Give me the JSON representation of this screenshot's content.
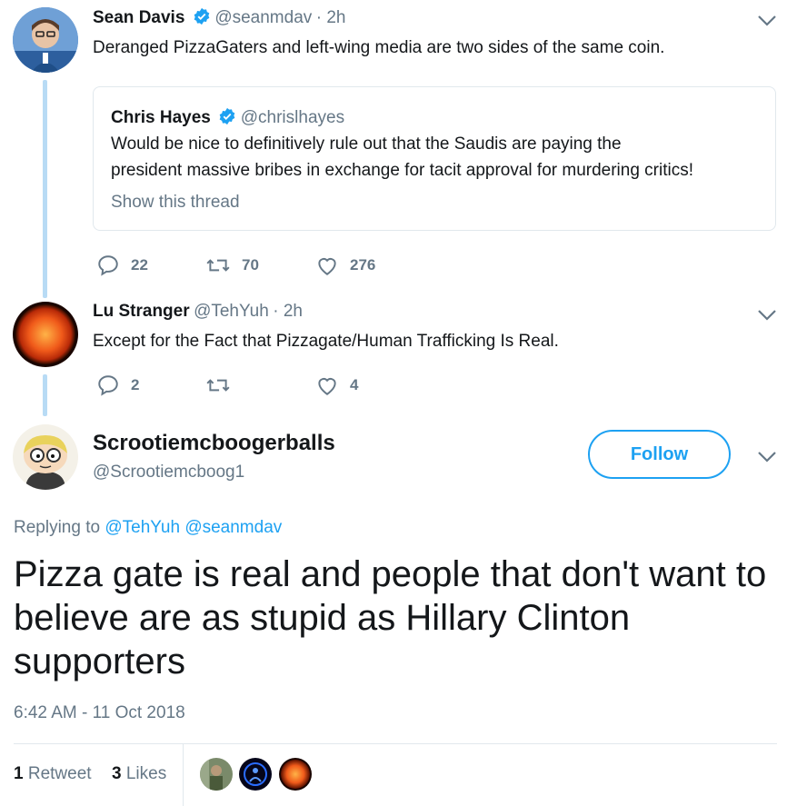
{
  "tweet1": {
    "name": "Sean Davis",
    "handle": "@seanmdav",
    "time": "· 2h",
    "text": "Deranged PizzaGaters and left-wing media are two sides of the same coin.",
    "quote": {
      "name": "Chris Hayes",
      "handle": "@chrislhayes",
      "text_line1": "Would be nice to definitively rule out that the Saudis are paying the",
      "text_line2": "president massive bribes in exchange for tacit approval for murdering critics!",
      "show_thread": "Show this thread"
    },
    "replies": "22",
    "retweets": "70",
    "likes": "276"
  },
  "tweet2": {
    "name": "Lu Stranger",
    "handle": "@TehYuh",
    "time": "· 2h",
    "text": "Except for the Fact that Pizzagate/Human Trafficking Is Real.",
    "replies": "2",
    "retweets": "",
    "likes": "4"
  },
  "main": {
    "name": "Scrootiemcboogerballs",
    "handle": "@Scrootiemcboog1",
    "follow_label": "Follow",
    "replying_prefix": "Replying to",
    "replying_to_1": "@TehYuh",
    "replying_to_2": "@seanmdav",
    "text": "Pizza gate is real and people that don't want to believe are as stupid as Hillary Clinton supporters",
    "timestamp": "6:42 AM - 11 Oct 2018",
    "retweet_count": "1",
    "retweet_label": "Retweet",
    "like_count": "3",
    "like_label": "Likes"
  },
  "colors": {
    "accent": "#1da1f2",
    "muted": "#657786",
    "thread_line": "#b8dbf5"
  }
}
